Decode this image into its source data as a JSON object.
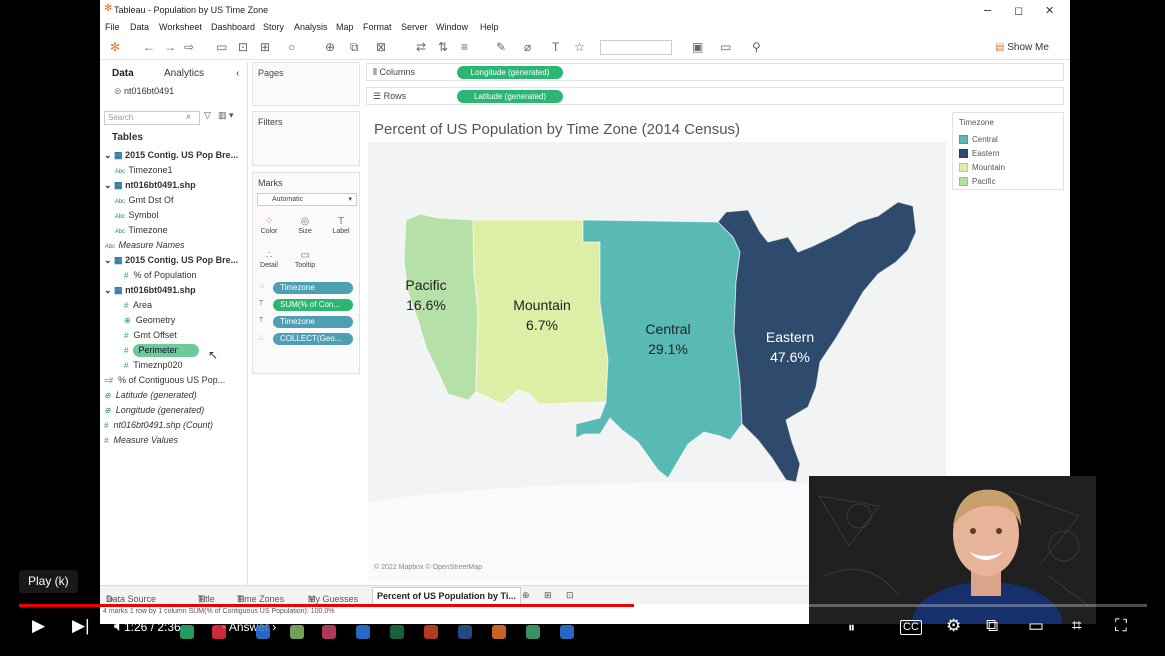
{
  "window": {
    "title": "Tableau - Population by US Time Zone",
    "controls": {
      "minimize": "–",
      "maximize": "◻",
      "close": "✕"
    }
  },
  "menu": [
    "File",
    "Data",
    "Worksheet",
    "Dashboard",
    "Story",
    "Analysis",
    "Map",
    "Format",
    "Server",
    "Window",
    "Help"
  ],
  "toolbar": {
    "show_me": "Show Me"
  },
  "data_pane": {
    "tab_data": "Data",
    "tab_analytics": "Analytics",
    "datasource": "nt016bt0491",
    "search_placeholder": "Search",
    "tables_heading": "Tables",
    "fields": [
      {
        "label": "2015 Contig. US Pop Bre...",
        "type": "table"
      },
      {
        "label": "Timezone1",
        "type": "Abc"
      },
      {
        "label": "nt016bt0491.shp",
        "type": "table"
      },
      {
        "label": "Gmt Dst Of",
        "type": "Abc"
      },
      {
        "label": "Symbol",
        "type": "Abc"
      },
      {
        "label": "Timezone",
        "type": "Abc"
      },
      {
        "label": "Measure Names",
        "type": "Abc",
        "italic": true
      },
      {
        "label": "2015 Contig. US Pop Bre...",
        "type": "table"
      },
      {
        "label": "% of Population",
        "type": "#"
      },
      {
        "label": "nt016bt0491.shp",
        "type": "table"
      },
      {
        "label": "Area",
        "type": "#"
      },
      {
        "label": "Geometry",
        "type": "geo"
      },
      {
        "label": "Gmt Offset",
        "type": "#"
      },
      {
        "label": "Perimeter",
        "type": "#",
        "highlight": true
      },
      {
        "label": "Timeznp020",
        "type": "#"
      },
      {
        "label": "% of Contiguous US Pop...",
        "type": "#"
      },
      {
        "label": "Latitude (generated)",
        "type": "geo",
        "italic": true
      },
      {
        "label": "Longitude (generated)",
        "type": "geo",
        "italic": true
      },
      {
        "label": "nt016bt0491.shp (Count)",
        "type": "#",
        "italic": true
      },
      {
        "label": "Measure Values",
        "type": "#",
        "italic": true
      }
    ]
  },
  "shelves": {
    "pages": "Pages",
    "filters": "Filters",
    "marks": "Marks",
    "mark_type": "Automatic",
    "mark_buttons": [
      "Color",
      "Size",
      "Label",
      "Detail",
      "Tooltip"
    ],
    "mark_pills": [
      "Timezone",
      "SUM(% of Con...",
      "Timezone",
      "COLLECT(Geo..."
    ],
    "columns_label": "Columns",
    "rows_label": "Rows",
    "columns_pill": "Longitude (generated)",
    "rows_pill": "Latitude (generated)"
  },
  "viz": {
    "title": "Percent of US Population by Time Zone (2014 Census)",
    "attribution": "© 2022 Mapbox © OpenStreetMap"
  },
  "chart_data": {
    "type": "map",
    "title": "Percent of US Population by Time Zone (2014 Census)",
    "regions": [
      {
        "name": "Pacific",
        "label": "16.6%",
        "value": 16.6,
        "color": "#b5e0a8"
      },
      {
        "name": "Mountain",
        "label": "6.7%",
        "value": 6.7,
        "color": "#ddefa6"
      },
      {
        "name": "Central",
        "label": "29.1%",
        "value": 29.1,
        "color": "#58b9b5"
      },
      {
        "name": "Eastern",
        "label": "47.6%",
        "value": 47.6,
        "color": "#2e4b6d"
      }
    ]
  },
  "legend": {
    "title": "Timezone",
    "items": [
      {
        "label": "Central",
        "color": "#58b9b5"
      },
      {
        "label": "Eastern",
        "color": "#2e4b6d"
      },
      {
        "label": "Mountain",
        "color": "#ddefa6"
      },
      {
        "label": "Pacific",
        "color": "#b5e0a8"
      }
    ]
  },
  "sheet_tabs": [
    "Data Source",
    "Title",
    "Time Zones",
    "My Guesses",
    "Percent of US Population by Ti..."
  ],
  "status": "4 marks   1 row by 1 column   SUM(% of Contiguous US Population): 100.0%",
  "player": {
    "tooltip": "Play (k)",
    "time": "1:26 / 2:36",
    "chapter": "• Answer ›",
    "progress": 0.545,
    "buffered": 0.555,
    "accent": "#ff0000"
  }
}
